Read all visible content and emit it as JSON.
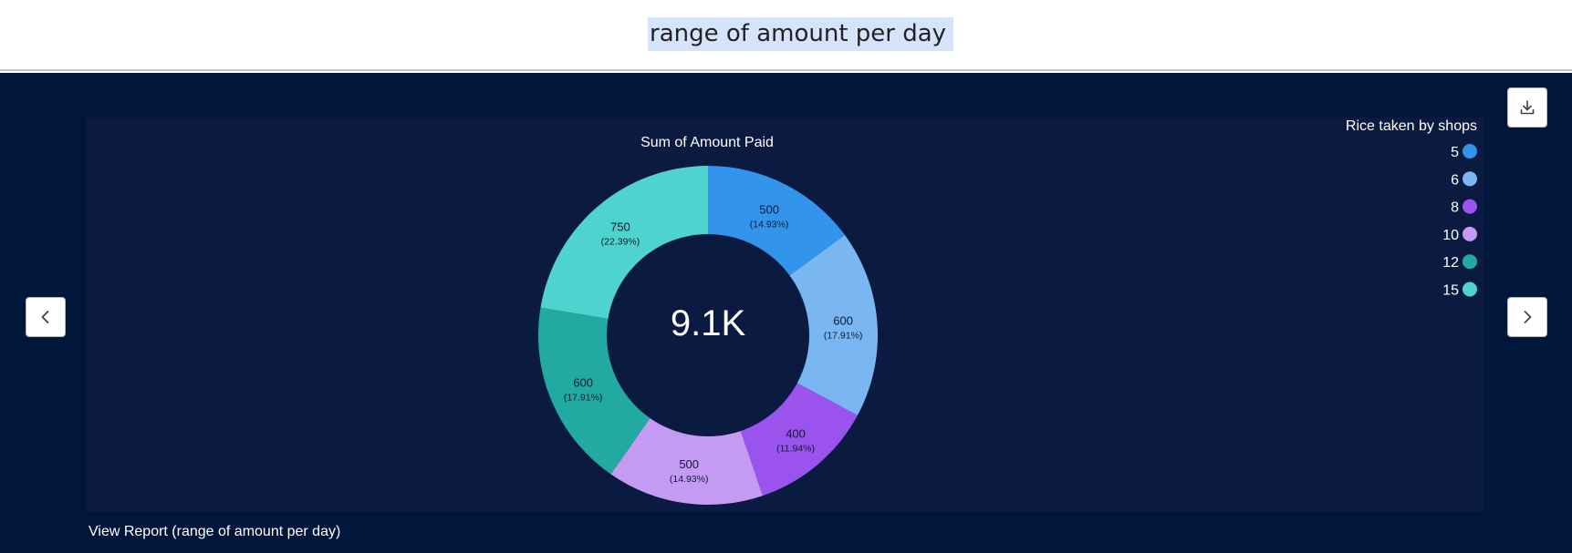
{
  "header": {
    "title": "range of amount per day"
  },
  "footer": {
    "view_report_label": "View Report (range of amount per day)"
  },
  "icons": {
    "prev": "chevron-left-icon",
    "next": "chevron-right-icon",
    "download": "download-icon"
  },
  "colors": {
    "background": "#00163b",
    "panel": "#0a1a40"
  },
  "chart_data": {
    "type": "pie",
    "title": "Sum of Amount Paid",
    "center_label": "9.1K",
    "legend_title": "Rice taken by shops",
    "legend_position": "top-right",
    "slices": [
      {
        "category": "5",
        "value": 500,
        "label": "500",
        "percent_label": "(14.93%)",
        "color": "#3394ec"
      },
      {
        "category": "6",
        "value": 600,
        "label": "600",
        "percent_label": "(17.91%)",
        "color": "#7ab7f2"
      },
      {
        "category": "8",
        "value": 400,
        "label": "400",
        "percent_label": "(11.94%)",
        "color": "#9b53ee"
      },
      {
        "category": "10",
        "value": 500,
        "label": "500",
        "percent_label": "(14.93%)",
        "color": "#c49af2"
      },
      {
        "category": "12",
        "value": 600,
        "label": "600",
        "percent_label": "(17.91%)",
        "color": "#21a9a2"
      },
      {
        "category": "15",
        "value": 750,
        "label": "750",
        "percent_label": "(22.39%)",
        "color": "#4fd3cf"
      }
    ]
  }
}
